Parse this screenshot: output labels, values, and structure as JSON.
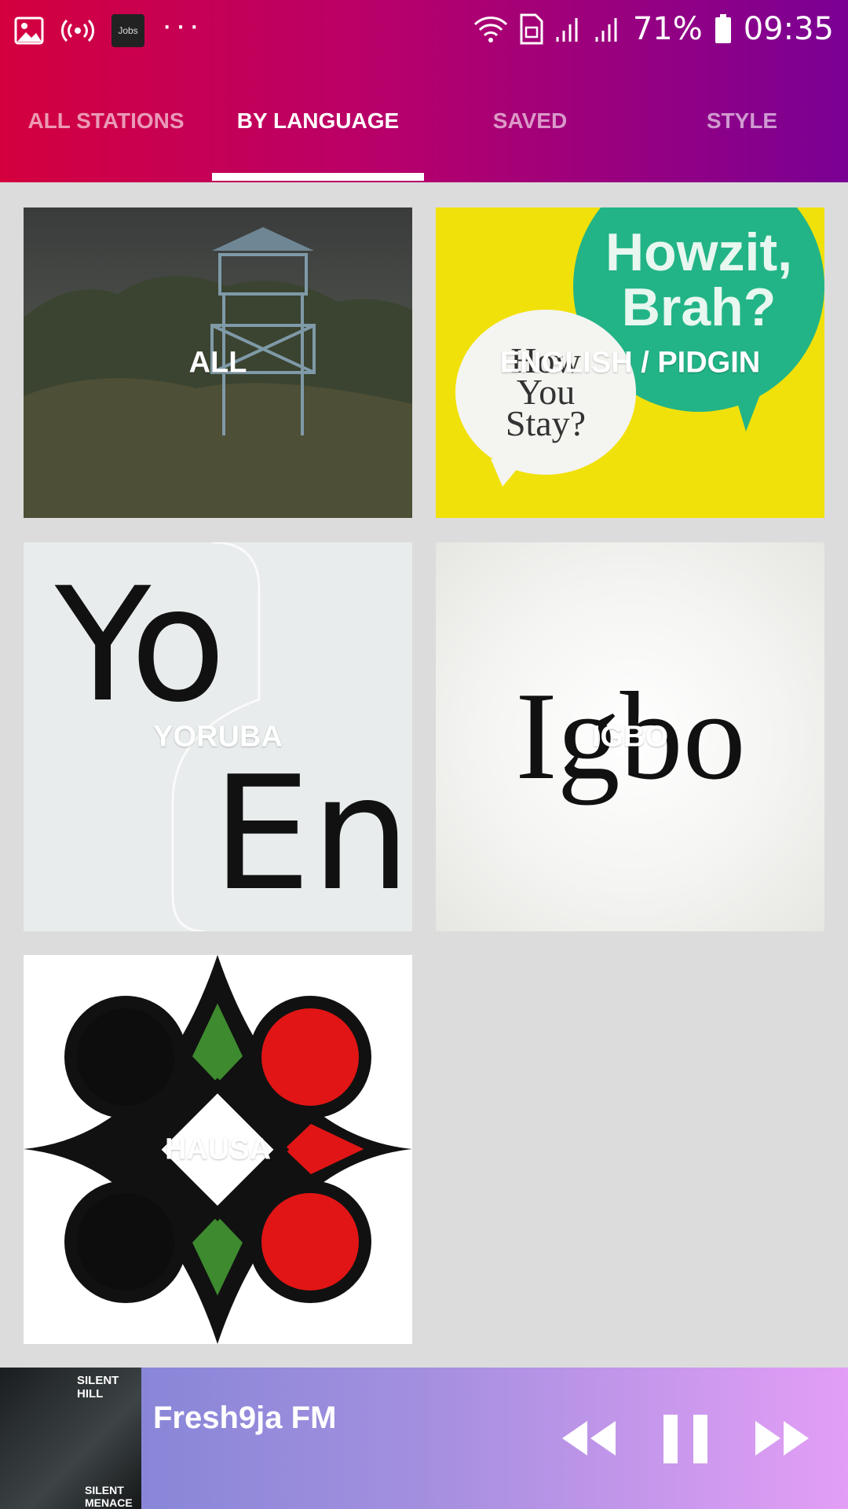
{
  "status_bar": {
    "app_icon_text": "Jobs",
    "more": "···",
    "battery": "71%",
    "time": "09:35"
  },
  "tabs": [
    {
      "label": "ALL STATIONS",
      "active": false
    },
    {
      "label": "BY LANGUAGE",
      "active": true
    },
    {
      "label": "SAVED",
      "active": false
    },
    {
      "label": "STYLE",
      "active": false
    }
  ],
  "languages": [
    {
      "label": "ALL",
      "art_text": ""
    },
    {
      "label": "ENGLISH / PIDGIN",
      "art_text": [
        "Howzit, Brah?",
        "How You Stay?"
      ]
    },
    {
      "label": "YORUBA",
      "art_text": [
        "Yo",
        "En"
      ]
    },
    {
      "label": "IGBO",
      "art_text": "Igbo"
    },
    {
      "label": "HAUSA",
      "art_text": ""
    }
  ],
  "player": {
    "station": "Fresh9ja FM",
    "album_text_top": "SILENT HILL",
    "album_text_bottom": "SILENT MENACE",
    "state": "playing"
  },
  "colors": {
    "header_start": "#d4003e",
    "header_end": "#7a0094",
    "background": "#dcdcdc",
    "player_start": "#7b82d4",
    "player_end": "#e39ef6"
  }
}
